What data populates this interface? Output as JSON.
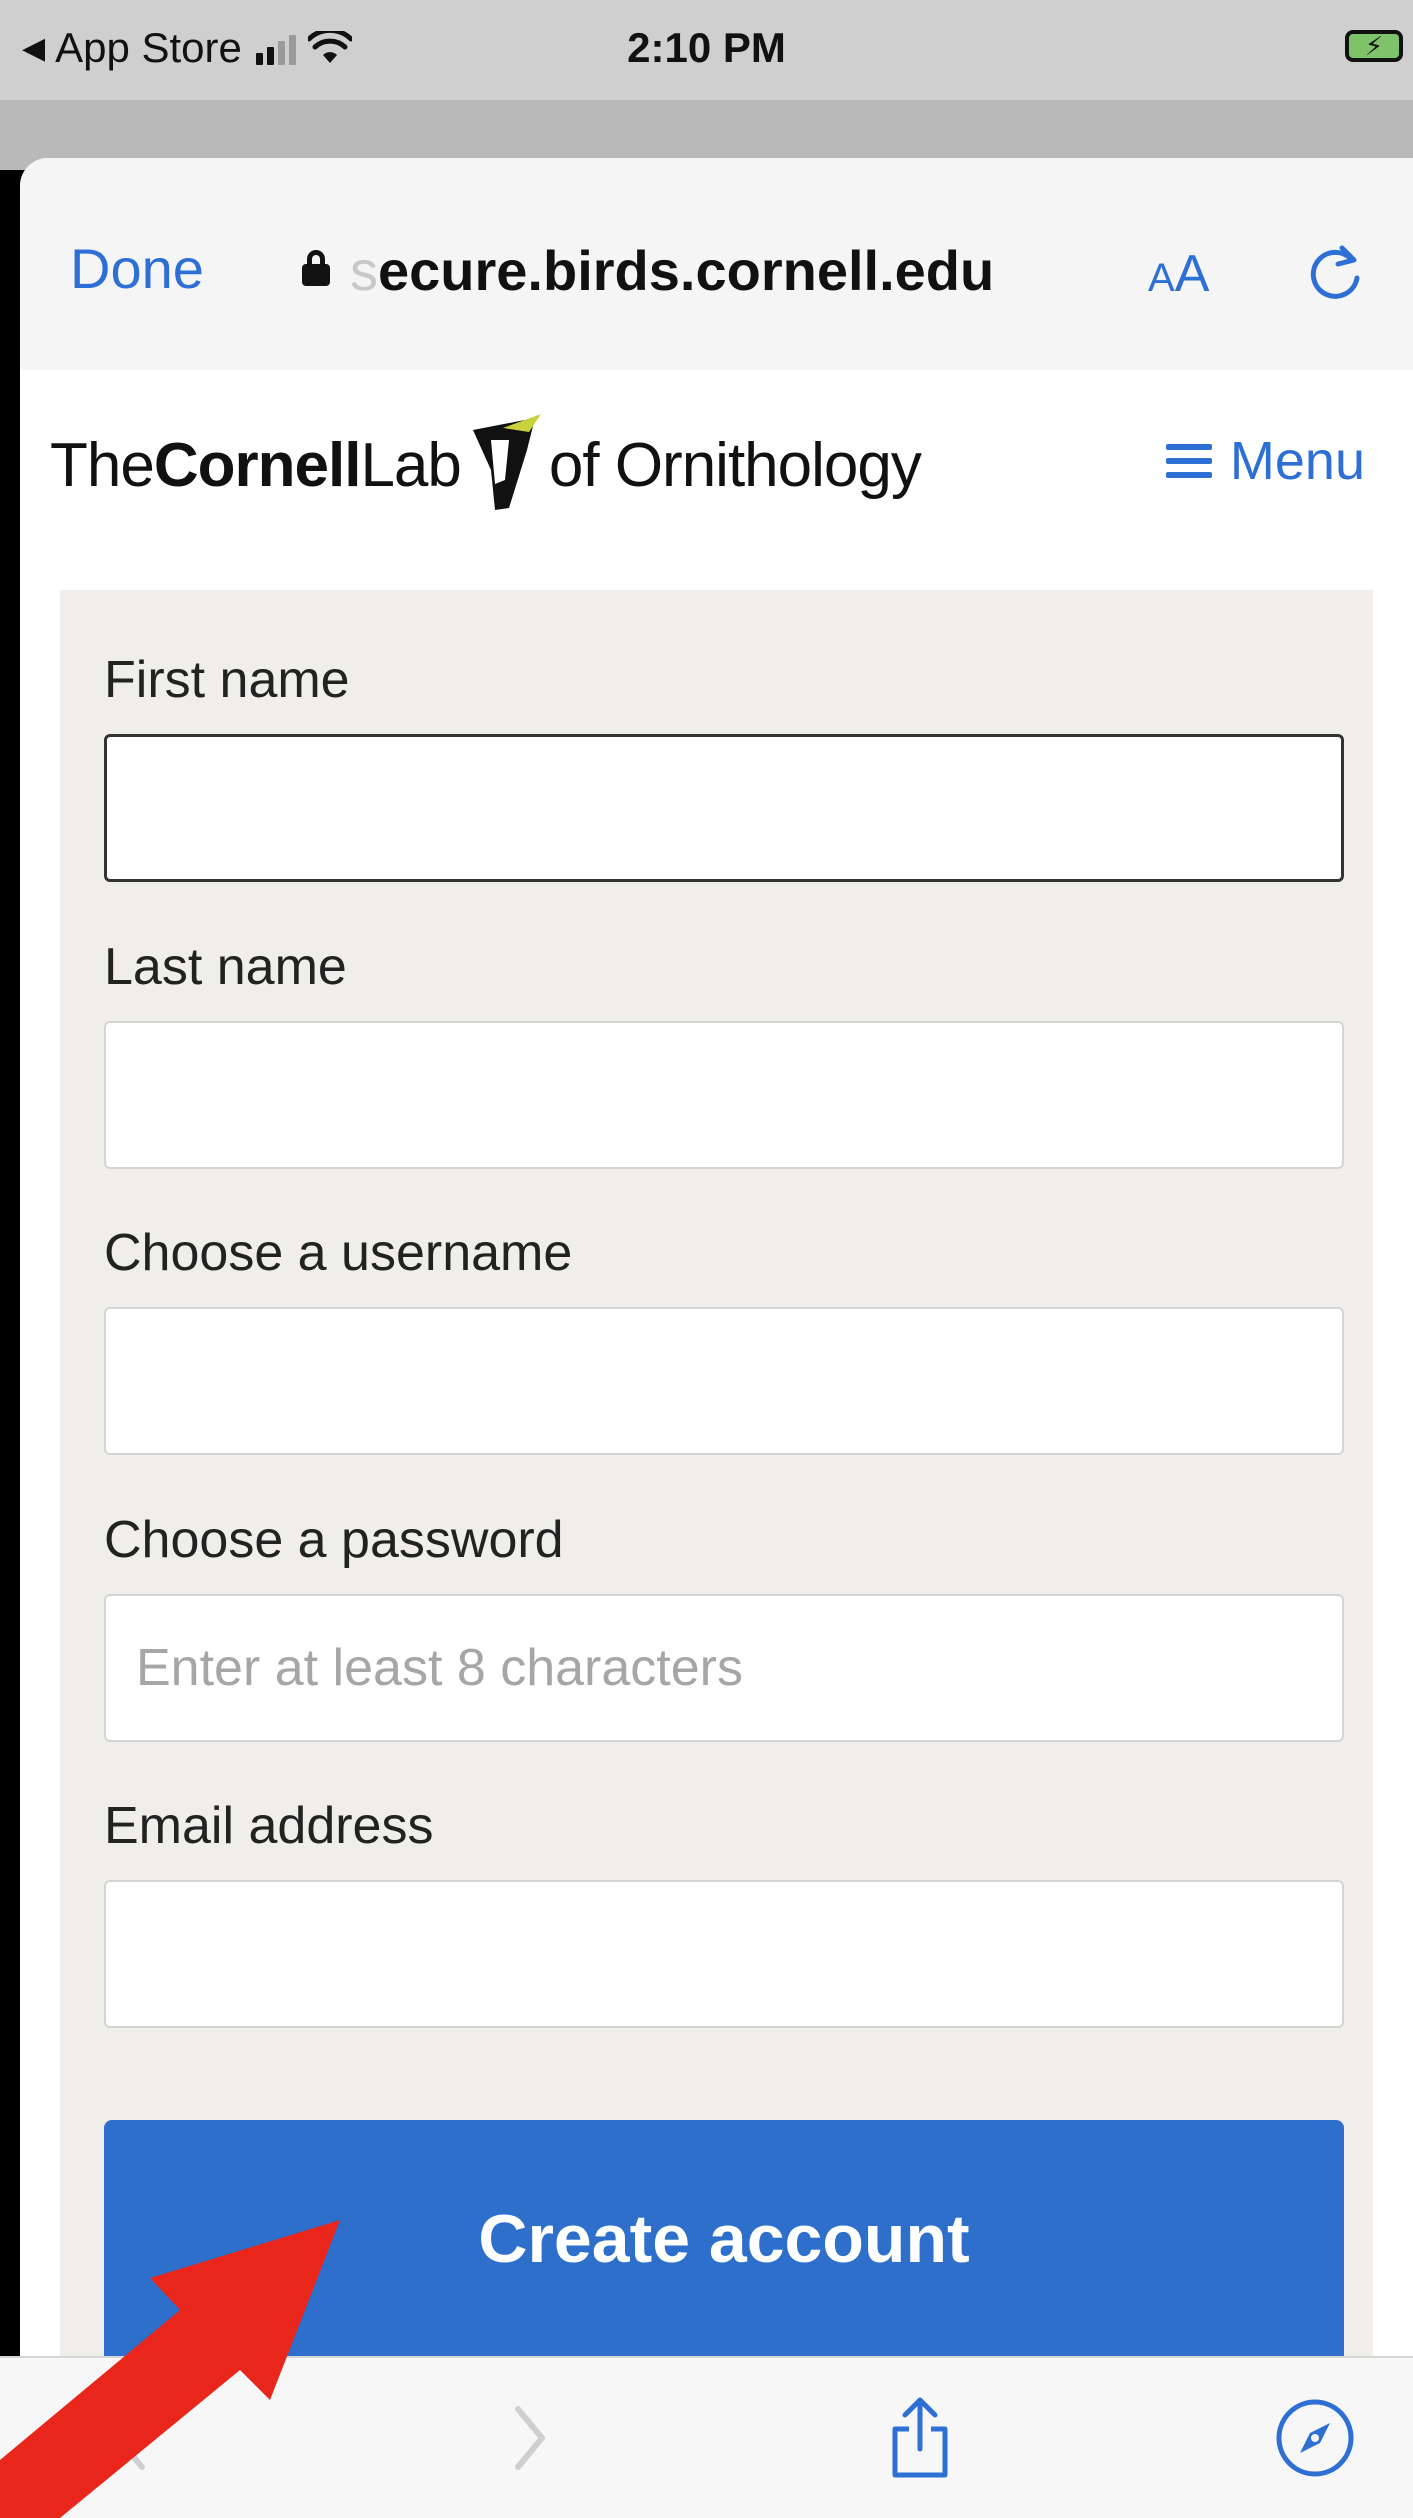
{
  "status_bar": {
    "back_app": "App Store",
    "time": "2:10 PM"
  },
  "browser": {
    "done_label": "Done",
    "url_hidden_prefix": "s",
    "url_visible": "ecure.birds.cornell.edu",
    "text_size_small": "A",
    "text_size_large": "A"
  },
  "site": {
    "logo": {
      "the": "The",
      "cornell": "Cornell",
      "lab": "Lab",
      "of_ornithology": "of Ornithology"
    },
    "menu_label": "Menu"
  },
  "form": {
    "fields": [
      {
        "label": "First name",
        "value": "",
        "placeholder": ""
      },
      {
        "label": "Last name",
        "value": "",
        "placeholder": ""
      },
      {
        "label": "Choose a username",
        "value": "",
        "placeholder": ""
      },
      {
        "label": "Choose a password",
        "value": "",
        "placeholder": "Enter at least 8 characters"
      },
      {
        "label": "Email address",
        "value": "",
        "placeholder": ""
      }
    ],
    "submit_label": "Create account"
  },
  "toolbar": {
    "back_icon": "chevron-left-icon",
    "forward_icon": "chevron-right-icon",
    "share_icon": "share-icon",
    "compass_icon": "compass-icon"
  },
  "colors": {
    "accent": "#2d6fd4",
    "button": "#2e6fcb",
    "panel": "#efeeeb",
    "annotation_arrow": "#e8261b"
  }
}
